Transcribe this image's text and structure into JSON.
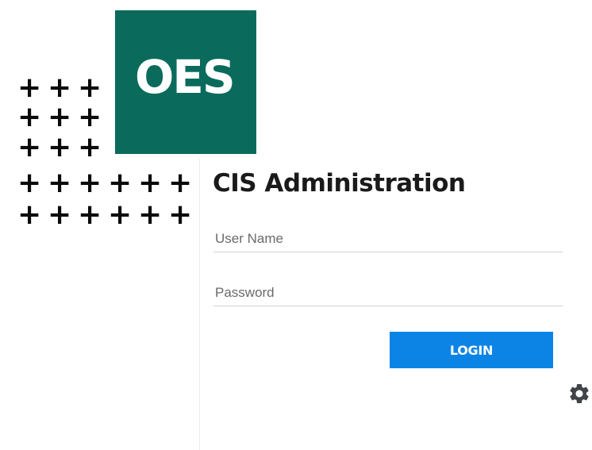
{
  "logo": {
    "text": "OES",
    "color": "#0a6b5c"
  },
  "decoration": {
    "glyph": "+",
    "rows": [
      3,
      3,
      3,
      6,
      6
    ]
  },
  "login": {
    "title": "CIS Administration",
    "username_placeholder": "User Name",
    "password_placeholder": "Password",
    "button_label": "LOGIN",
    "button_color": "#0b84e6"
  },
  "settings": {
    "icon": "gear-icon"
  }
}
